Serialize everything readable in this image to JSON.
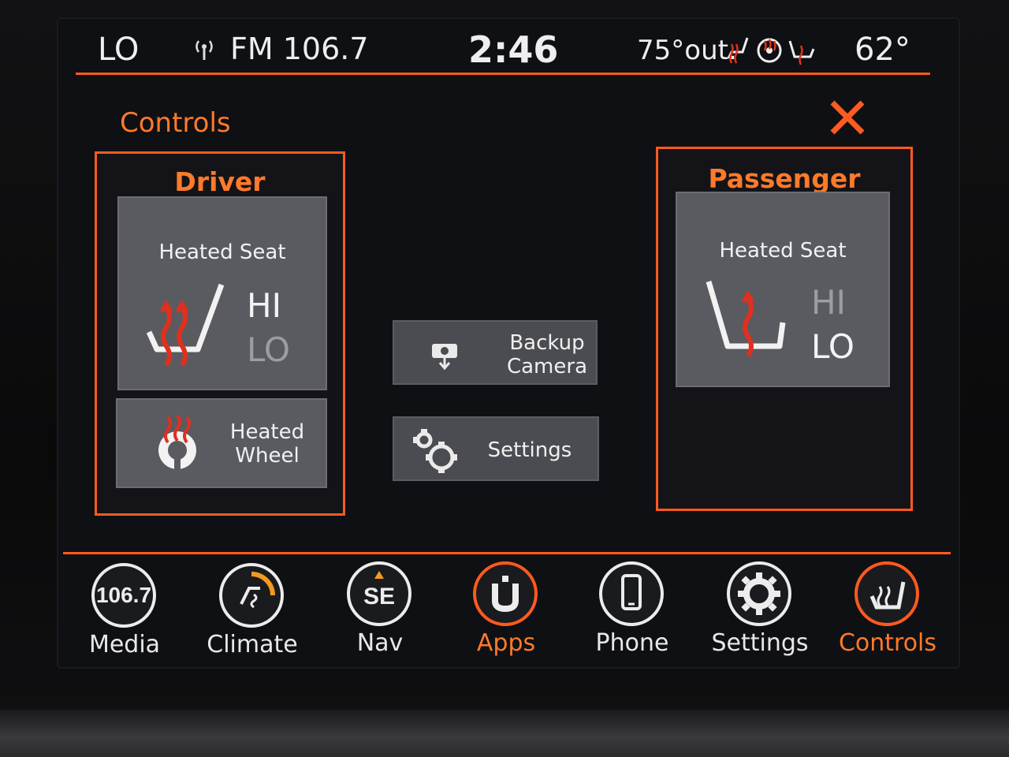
{
  "status_bar": {
    "temp_left": "LO",
    "radio_icon": "radio-signal-icon",
    "radio": "FM 106.7",
    "clock": "2:46",
    "outside_temp": "75°out.",
    "temp_right": "62°",
    "icons": [
      "heated-seat-status-icon",
      "heated-wheel-status-icon",
      "seat-status-icon"
    ]
  },
  "page": {
    "title": "Controls",
    "close_icon": "close-icon"
  },
  "driver": {
    "title": "Driver",
    "heated_seat": {
      "label": "Heated Seat",
      "hi": "HI",
      "lo": "LO",
      "active_level": "HI"
    },
    "heated_wheel": {
      "line1": "Heated",
      "line2": "Wheel"
    }
  },
  "passenger": {
    "title": "Passenger",
    "heated_seat": {
      "label": "Heated Seat",
      "hi": "HI",
      "lo": "LO",
      "active_level": "LO"
    }
  },
  "middle": {
    "backup_camera": {
      "line1": "Backup",
      "line2": "Camera"
    },
    "settings": {
      "label": "Settings"
    }
  },
  "dock": [
    {
      "label": "Media",
      "icon_text": "106.7",
      "active": false
    },
    {
      "label": "Climate",
      "icon_text": "",
      "active": false
    },
    {
      "label": "Nav",
      "icon_text": "SE",
      "active": false
    },
    {
      "label": "Apps",
      "icon_text": "",
      "active": true
    },
    {
      "label": "Phone",
      "icon_text": "",
      "active": false
    },
    {
      "label": "Settings",
      "icon_text": "",
      "active": false
    },
    {
      "label": "Controls",
      "icon_text": "",
      "active": true
    }
  ],
  "colors": {
    "accent": "#ff5a1f",
    "accent_text": "#ff7a2a",
    "heat": "#e0301e",
    "tile": "#5a5b61"
  }
}
